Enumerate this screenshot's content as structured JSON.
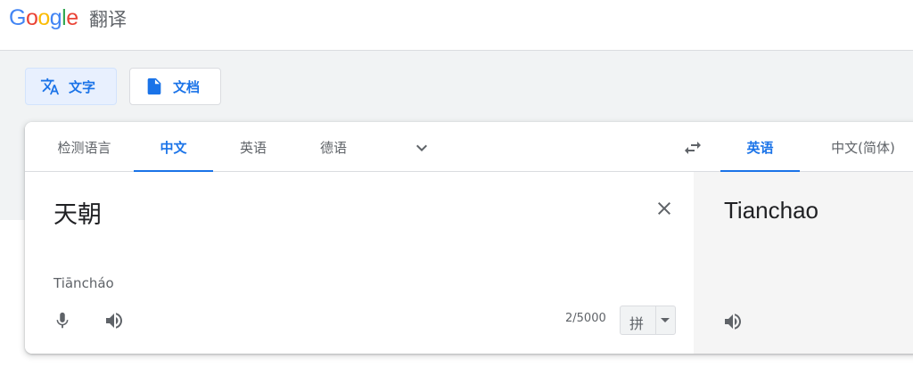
{
  "header": {
    "logo_letters": [
      {
        "ch": "G",
        "color": "#4285F4"
      },
      {
        "ch": "o",
        "color": "#EA4335"
      },
      {
        "ch": "o",
        "color": "#FBBC05"
      },
      {
        "ch": "g",
        "color": "#4285F4"
      },
      {
        "ch": "l",
        "color": "#34A853"
      },
      {
        "ch": "e",
        "color": "#EA4335"
      }
    ],
    "product_name": "翻译"
  },
  "modes": {
    "text_label": "文字",
    "docs_label": "文档",
    "active": "text"
  },
  "source_langs": {
    "detect": "检测语言",
    "items": [
      "中文",
      "英语",
      "德语"
    ],
    "active_index": 0
  },
  "target_langs": {
    "items": [
      "英语",
      "中文(简体)"
    ],
    "active_index": 0
  },
  "source": {
    "text": "天朝",
    "romanization": "Tiāncháo",
    "char_count": "2/5000",
    "input_method": "拼"
  },
  "target": {
    "text": "Tianchao"
  },
  "icons": {
    "translate_text": "translate-icon",
    "document": "document-icon",
    "more_source_langs": "chevron-down-icon",
    "swap": "swap-languages-icon",
    "clear": "close-icon",
    "mic": "microphone-icon",
    "listen_source": "speaker-icon",
    "listen_target": "speaker-icon"
  },
  "colors": {
    "accent": "#1a73e8",
    "active_mode_bg": "#e8f0fe",
    "band_bg": "#f1f3f4",
    "target_bg": "#f5f5f5"
  }
}
